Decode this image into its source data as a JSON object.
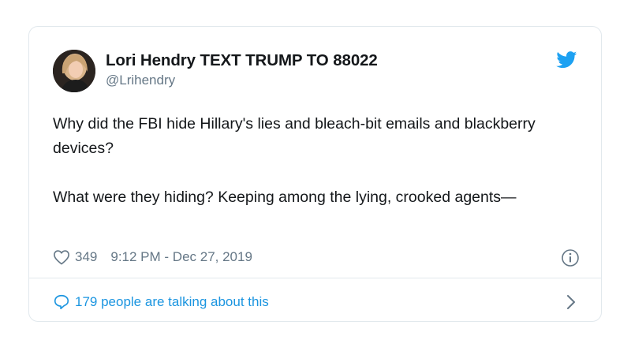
{
  "tweet": {
    "author_name": "Lori Hendry TEXT TRUMP TO 88022",
    "author_handle": "@Lrihendry",
    "paragraphs": [
      "Why did the FBI hide Hillary's lies and bleach-bit emails and blackberry devices?",
      "What were they hiding? Keeping among the lying, crooked agents—"
    ],
    "likes": "349",
    "timestamp": "9:12 PM - Dec 27, 2019",
    "talking_text": "179 people are talking about this"
  },
  "icons": {
    "brand": "twitter-bird-icon",
    "like": "heart-icon",
    "info": "info-icon",
    "reply": "speech-bubble-icon",
    "more": "chevron-right-icon"
  },
  "colors": {
    "accent": "#1b95e0",
    "text": "#14171a",
    "muted": "#657786",
    "border": "#e1e8ed"
  }
}
